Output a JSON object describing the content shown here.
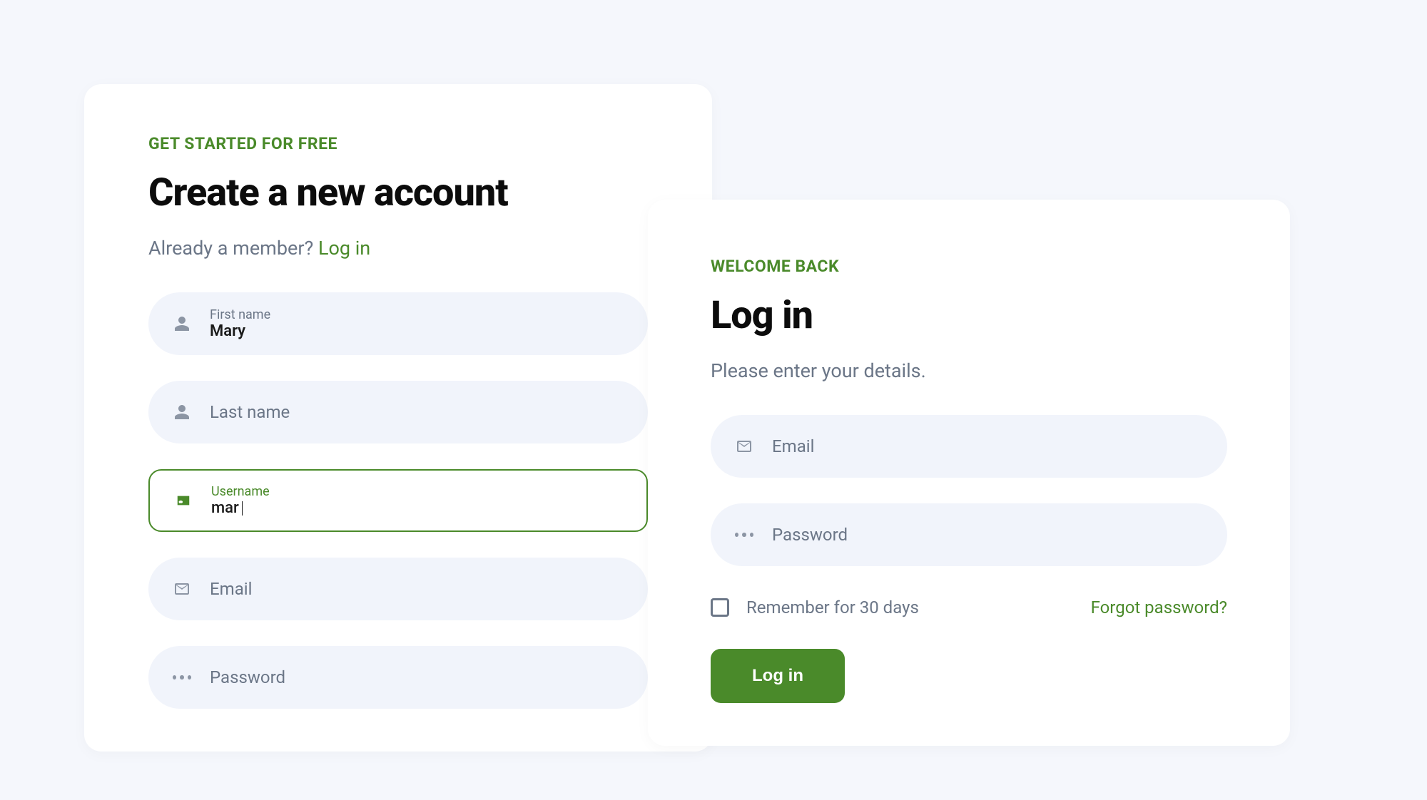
{
  "signup": {
    "eyebrow": "GET STARTED FOR FREE",
    "title": "Create a new account",
    "member_text": "Already a member? ",
    "login_link": "Log in",
    "fields": {
      "firstname": {
        "label": "First name",
        "value": "Mary"
      },
      "lastname": {
        "placeholder": "Last name"
      },
      "username": {
        "label": "Username",
        "value": "mar"
      },
      "email": {
        "placeholder": "Email"
      },
      "password": {
        "placeholder": "Password"
      }
    }
  },
  "login": {
    "eyebrow": "WELCOME BACK",
    "title": "Log in",
    "subtitle": "Please enter your details.",
    "fields": {
      "email": {
        "placeholder": "Email"
      },
      "password": {
        "placeholder": "Password"
      }
    },
    "remember_label": "Remember for 30 days",
    "forgot_link": "Forgot password?",
    "submit_label": "Log in"
  }
}
